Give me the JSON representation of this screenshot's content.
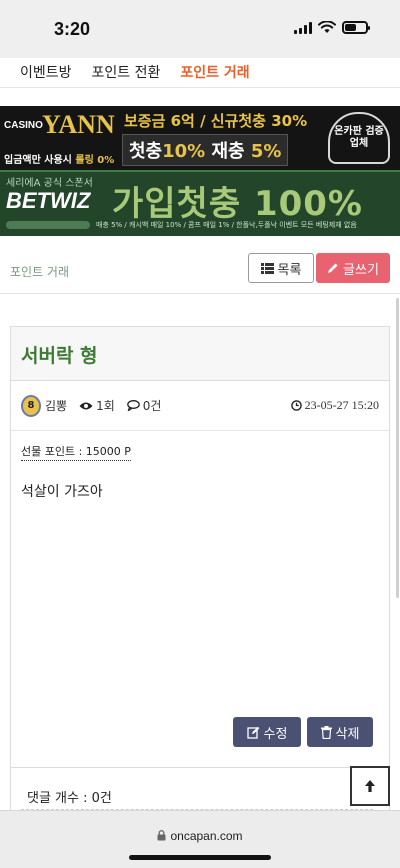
{
  "status_bar": {
    "time": "3:20"
  },
  "nav": {
    "items": [
      {
        "label": "이벤트방"
      },
      {
        "label": "포인트 전환"
      },
      {
        "label": "포인트 거래"
      }
    ]
  },
  "banners": {
    "banner1": {
      "logo_prefix": "CASINO",
      "logo_name": "YANN",
      "subline_text": "입금액만 사용시 ",
      "subline_highlight": "롤링 0%",
      "headline": "보증금 6억 / 신규첫충 30%",
      "bonus_first": "첫충",
      "bonus_first_pct": "10%",
      "bonus_re": "재충",
      "bonus_re_pct": "5%",
      "badge": "온카판 검증업체"
    },
    "banner2": {
      "sponsor": "세리에A 공식 스폰서",
      "logo": "BETWIZ",
      "headline": "가입첫충 100%",
      "footer": "매충 5% / 캐시백 매일 10% / 콤프 매일 1% / 한폴낙,두폴낙 이벤트  모든 베팅제재 없음"
    }
  },
  "breadcrumb": {
    "label": "포인트 거래"
  },
  "buttons": {
    "list": "목록",
    "write": "글쓰기",
    "edit": "수정",
    "delete": "삭제"
  },
  "post": {
    "title": "서버락 형",
    "author_level": "8",
    "author": "김뽕",
    "views": "1회",
    "comments": "0건",
    "date": "23-05-27 15:20",
    "gift_points": "선물 포인트 : 15000 P",
    "body": "석살이 가즈아"
  },
  "comments": {
    "count_label": "댓글 개수 : 0건"
  },
  "browser": {
    "url": "oncapan.com"
  },
  "colors": {
    "accent_orange": "#e8602c",
    "write_button": "#e8636f",
    "action_button": "#4b5173",
    "title_green": "#3d7a33"
  }
}
